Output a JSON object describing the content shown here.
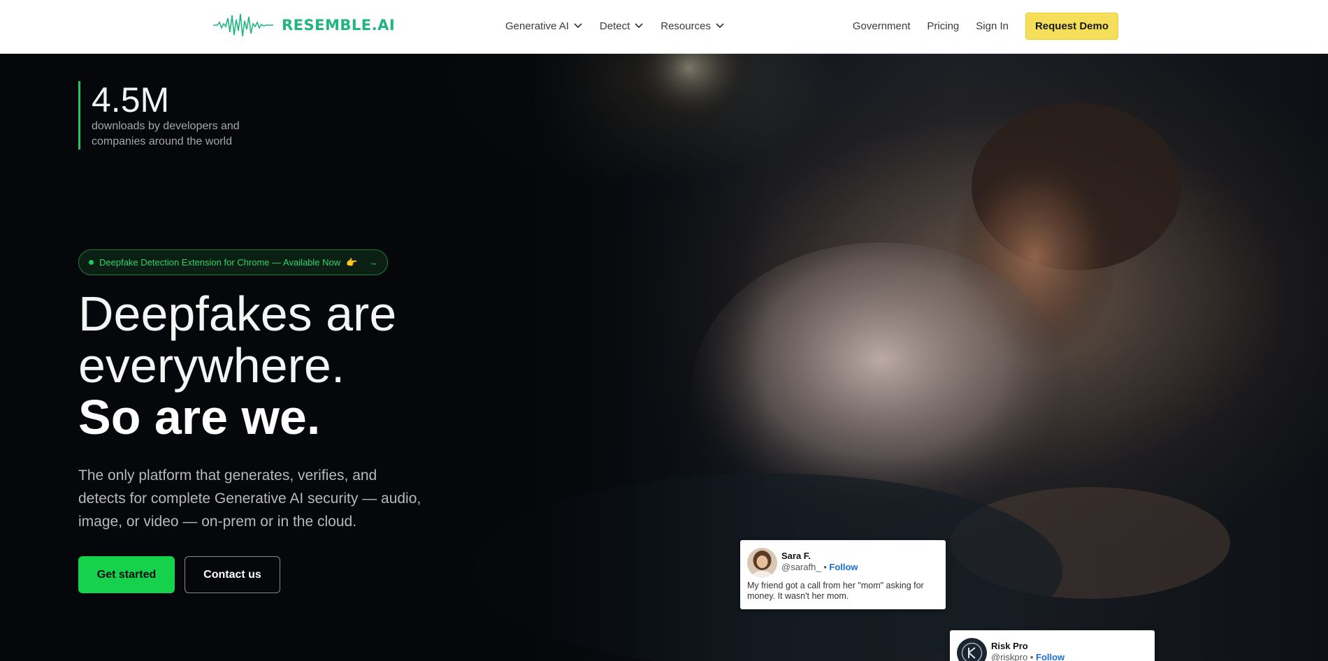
{
  "nav": {
    "logo_text": "RESEMBLE.AI",
    "menu": [
      {
        "label": "Generative AI"
      },
      {
        "label": "Detect"
      },
      {
        "label": "Resources"
      }
    ],
    "right_links": [
      "Government",
      "Pricing",
      "Sign In"
    ],
    "demo_label": "Request Demo"
  },
  "hero": {
    "stat_value": "4.5M",
    "stat_desc": "downloads by developers and companies around the world",
    "pill_text": "Deepfake Detection Extension for Chrome — Available Now",
    "pill_emoji": "👉",
    "pill_arrow": "→",
    "headline_1": "Deepfakes are",
    "headline_2": "everywhere.",
    "headline_3": "So are we.",
    "subtitle": "The only platform that generates, verifies, and detects for complete Generative AI security — audio, image, or video — on-prem or in the cloud.",
    "cta_primary": "Get started",
    "cta_secondary": "Contact us"
  },
  "tweets": [
    {
      "name": "Sara F.",
      "handle": "@sarafh_",
      "separator": "•",
      "follow": "Follow",
      "text": "My friend got a call from her \"mom\" asking for money. It wasn't her mom."
    },
    {
      "name": "Risk Pro",
      "handle": "@riskpro",
      "separator": "•",
      "follow": "Follow"
    }
  ],
  "colors": {
    "brand_green": "#21b57f",
    "accent_green": "#16d14b",
    "demo_yellow": "#f5df5a",
    "follow_blue": "#1a6fd6"
  }
}
